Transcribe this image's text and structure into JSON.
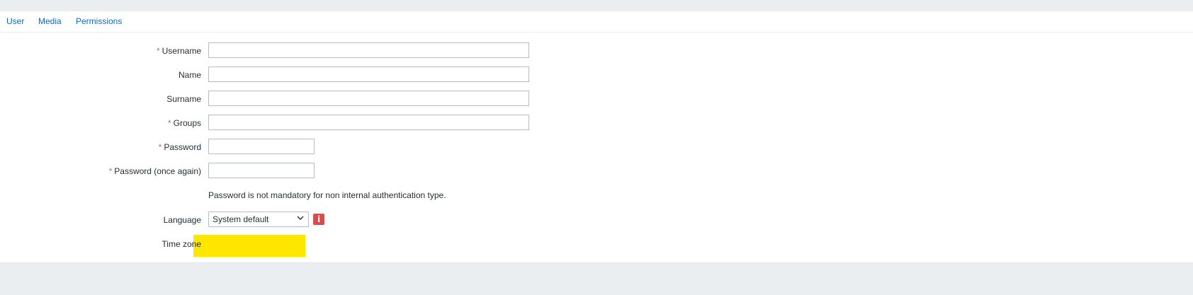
{
  "tabs": [
    {
      "label": "User"
    },
    {
      "label": "Media"
    },
    {
      "label": "Permissions"
    }
  ],
  "form": {
    "username_label": "Username",
    "name_label": "Name",
    "surname_label": "Surname",
    "groups_label": "Groups",
    "password_label": "Password",
    "password_again_label": "Password (once again)",
    "password_hint": "Password is not mandatory for non internal authentication type.",
    "language_label": "Language",
    "language_value": "System default",
    "timezone_label": "Time zone",
    "required_marker": "*",
    "info_glyph": "i"
  },
  "colors": {
    "link": "#0a6bbd",
    "required": "#e45959",
    "info_icon": "#d64e4e",
    "highlight": "#ffe600"
  },
  "icons": {
    "language_dropdown": "chevron-down-icon",
    "language_info": "info-icon"
  }
}
